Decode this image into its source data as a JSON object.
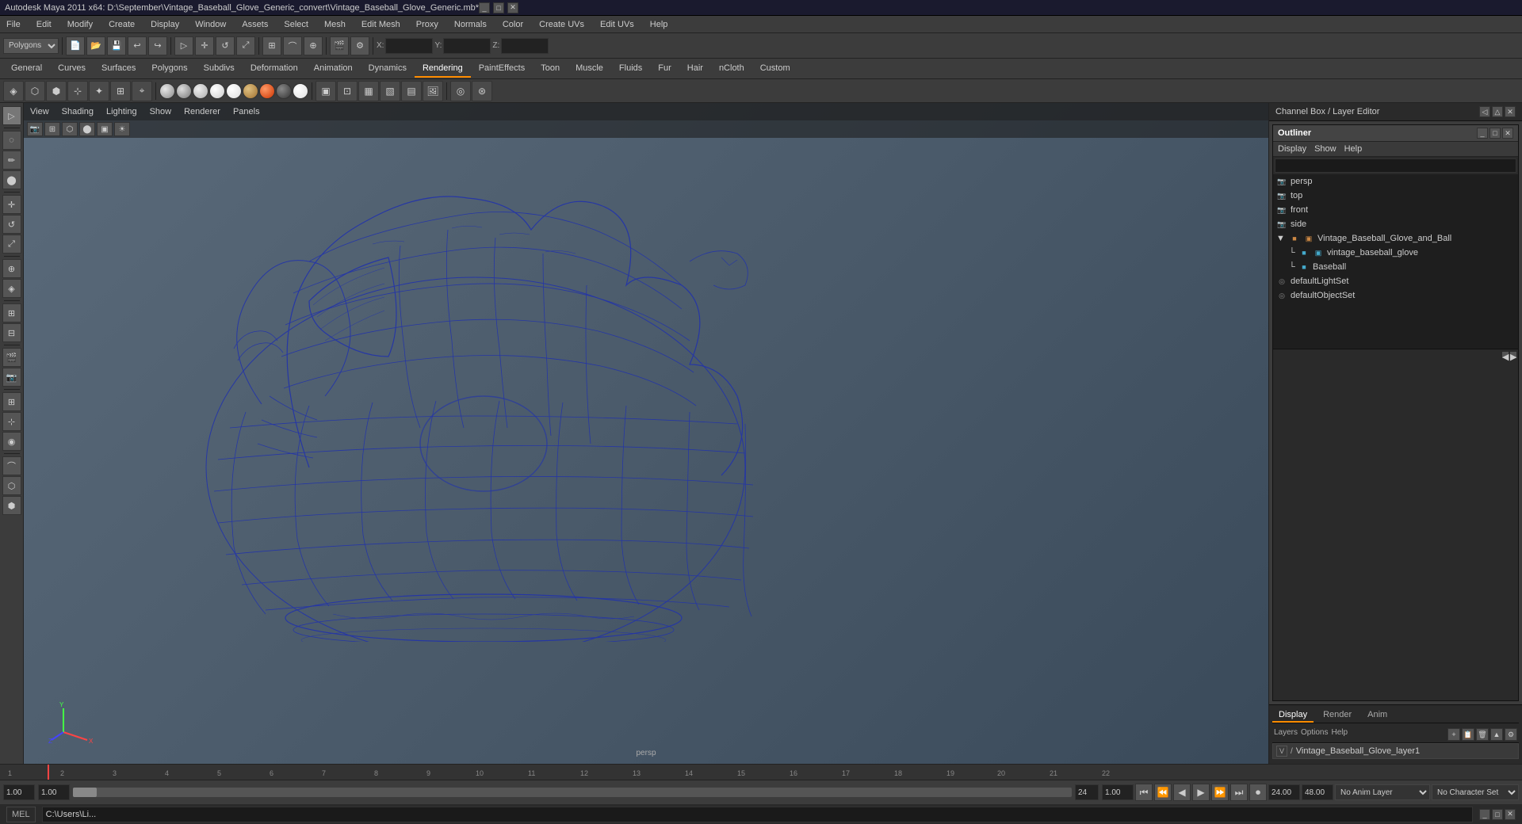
{
  "window": {
    "title": "Autodesk Maya 2011 x64: D:\\September\\Vintage_Baseball_Glove_Generic_convert\\Vintage_Baseball_Glove_Generic.mb*",
    "controls": [
      "_",
      "□",
      "✕"
    ]
  },
  "menu_bar": {
    "items": [
      "File",
      "Edit",
      "Modify",
      "Create",
      "Display",
      "Window",
      "Assets",
      "Select",
      "Mesh",
      "Edit Mesh",
      "Proxy",
      "Normals",
      "Color",
      "Create UVs",
      "Edit UVs",
      "Help"
    ]
  },
  "toolbar1": {
    "mode_select": "Polygons",
    "fields": [
      "X:",
      "Y:",
      "Z:"
    ]
  },
  "tab_bar": {
    "tabs": [
      "General",
      "Curves",
      "Surfaces",
      "Polygons",
      "Subdivs",
      "Deformation",
      "Animation",
      "Dynamics",
      "Rendering",
      "PaintEffects",
      "Toon",
      "Muscle",
      "Fluids",
      "Fur",
      "Hair",
      "nCloth",
      "Custom"
    ],
    "active": "Rendering"
  },
  "viewport_menu": {
    "items": [
      "View",
      "Shading",
      "Lighting",
      "Show",
      "Renderer",
      "Panels"
    ]
  },
  "viewport": {
    "camera": "persp",
    "label": "persp"
  },
  "outliner": {
    "title": "Outliner",
    "menu_items": [
      "Display",
      "Show",
      "Help"
    ],
    "search_placeholder": "",
    "items": [
      {
        "id": "persp",
        "label": "persp",
        "type": "camera",
        "indent": 0
      },
      {
        "id": "top",
        "label": "top",
        "type": "camera",
        "indent": 0
      },
      {
        "id": "front",
        "label": "front",
        "type": "camera",
        "indent": 0
      },
      {
        "id": "side",
        "label": "side",
        "type": "camera",
        "indent": 0
      },
      {
        "id": "glove_group",
        "label": "Vintage_Baseball_Glove_and_Ball",
        "type": "group",
        "indent": 0,
        "expanded": true
      },
      {
        "id": "glove_mesh",
        "label": "vintage_baseball_glove",
        "type": "mesh",
        "indent": 1
      },
      {
        "id": "baseball",
        "label": "Baseball",
        "type": "mesh",
        "indent": 1
      },
      {
        "id": "defaultLightSet",
        "label": "defaultLightSet",
        "type": "set",
        "indent": 0
      },
      {
        "id": "defaultObjectSet",
        "label": "defaultObjectSet",
        "type": "set",
        "indent": 0
      }
    ]
  },
  "channel_box": {
    "title": "Channel Box / Layer Editor",
    "tabs": [
      "Display",
      "Render",
      "Anim"
    ],
    "active_tab": "Display",
    "sub_tabs": [
      "Layers",
      "Options",
      "Help"
    ]
  },
  "layers": {
    "items": [
      {
        "name": "Vintage_Baseball_Glove_layer1",
        "visible": true,
        "prefix": "/"
      }
    ]
  },
  "timeline": {
    "start": "1.00",
    "end": "24.00",
    "current": "1",
    "range_start": "1.00",
    "range_end": "24.00",
    "anim_end": "48.00"
  },
  "playback": {
    "buttons": [
      "⏮",
      "⏪",
      "◀",
      "▶",
      "⏩",
      "⏭",
      "⏺"
    ]
  },
  "bottom_bar": {
    "start_frame": "1.00",
    "current_frame": "1.00",
    "frame_marker": "1",
    "end_frame": "24",
    "anim_layer": "No Anim Layer",
    "char_set": "No Character Set",
    "anim_end_field": "24.00",
    "anim_end2": "48.00"
  },
  "status_bar": {
    "mode": "MEL",
    "input_value": "C:\\Users\\Li...",
    "taskbar_buttons": [
      "_",
      "□",
      "✕"
    ]
  },
  "frame_ticks": [
    "1",
    "2",
    "3",
    "4",
    "5",
    "6",
    "7",
    "8",
    "9",
    "10",
    "11",
    "12",
    "13",
    "14",
    "15",
    "16",
    "17",
    "18",
    "19",
    "20",
    "21",
    "22"
  ],
  "colors": {
    "accent": "#ff8c00",
    "wireframe_blue": "#2233aa",
    "background_gradient_top": "#6a7a8a",
    "background_gradient_bottom": "#3a4a5a",
    "ui_bg": "#3c3c3c",
    "panel_bg": "#2a2a2a",
    "dark_bg": "#1e1e1e"
  },
  "spheres": [
    {
      "color": "#d4a030",
      "label": "sphere1"
    },
    {
      "color": "#888",
      "label": "sphere2"
    },
    {
      "color": "#aaa",
      "label": "sphere3"
    },
    {
      "color": "#ccc",
      "label": "sphere4"
    },
    {
      "color": "#ddd",
      "label": "sphere5"
    },
    {
      "color": "#bba055",
      "label": "sphere6"
    },
    {
      "color": "#ff4400",
      "label": "sphere7"
    },
    {
      "color": "#555",
      "label": "sphere8"
    },
    {
      "color": "#eee",
      "label": "sphere9"
    }
  ]
}
